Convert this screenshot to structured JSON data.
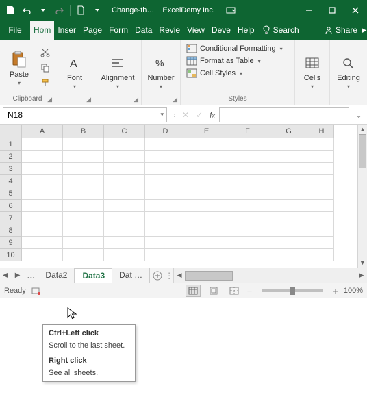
{
  "title": {
    "doc": "Change-th…",
    "org": "ExcelDemy Inc."
  },
  "tabs": {
    "file": "File",
    "list": [
      "Hom",
      "Inser",
      "Page",
      "Form",
      "Data",
      "Revie",
      "View",
      "Deve",
      "Help"
    ],
    "active_index": 0,
    "search": "Search",
    "share": "Share"
  },
  "ribbon": {
    "clipboard": {
      "paste": "Paste",
      "label": "Clipboard"
    },
    "font": {
      "btn": "Font",
      "label": ""
    },
    "alignment": {
      "btn": "Alignment",
      "label": ""
    },
    "number": {
      "btn": "Number",
      "label": ""
    },
    "styles": {
      "cond": "Conditional Formatting",
      "table": "Format as Table",
      "cell": "Cell Styles",
      "label": "Styles"
    },
    "cells": {
      "btn": "Cells",
      "label": ""
    },
    "editing": {
      "btn": "Editing",
      "label": ""
    }
  },
  "namebox": "N18",
  "columns": [
    "A",
    "B",
    "C",
    "D",
    "E",
    "F",
    "G",
    "H"
  ],
  "rows": [
    "1",
    "2",
    "3",
    "4",
    "5",
    "6",
    "7",
    "8",
    "9",
    "10"
  ],
  "sheets": {
    "tabs": [
      "Data2",
      "Data3",
      "Dat …"
    ],
    "active_index": 1,
    "ellipsis": "…"
  },
  "status": {
    "ready": "Ready",
    "zoom": "100%"
  },
  "tooltip": {
    "h1": "Ctrl+Left click",
    "l1": "Scroll to the last sheet.",
    "h2": "Right click",
    "l2": "See all sheets."
  }
}
